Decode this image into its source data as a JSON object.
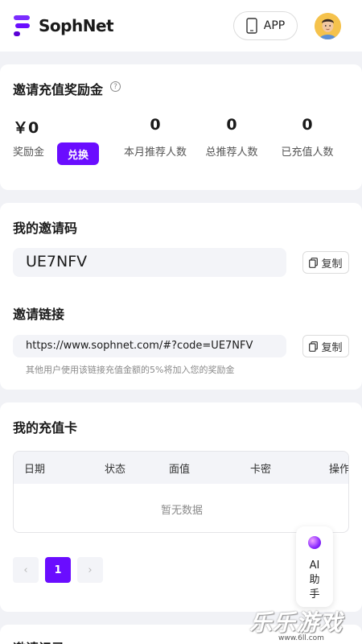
{
  "header": {
    "brand": "SophNet",
    "app_label": "APP",
    "icons": {
      "logo": "sophnet-logo-icon",
      "app": "phone-icon",
      "avatar": "user-avatar"
    },
    "colors": {
      "brand_purple": "#6a0dff"
    }
  },
  "reward": {
    "title": "邀请充值奖励金",
    "help_icon": "question-circle-icon",
    "balance_value": "￥0",
    "balance_label": "奖励金",
    "redeem_label": "兑换",
    "stats": [
      {
        "value": "0",
        "label": "本月推荐人数"
      },
      {
        "value": "0",
        "label": "总推荐人数"
      },
      {
        "value": "0",
        "label": "已充值人数"
      }
    ]
  },
  "invite_code": {
    "title": "我的邀请码",
    "code": "UE7NFV",
    "copy_label": "复制"
  },
  "invite_link": {
    "title": "邀请链接",
    "url": "https://www.sophnet.com/#?code=UE7NFV",
    "copy_label": "复制",
    "hint": "其他用户使用该链接充值金额的5%将加入您的奖励金"
  },
  "recharge_cards": {
    "title": "我的充值卡",
    "columns": [
      "日期",
      "状态",
      "面值",
      "卡密",
      "操作"
    ],
    "empty_text": "暂无数据",
    "pagination": {
      "prev": "‹",
      "current": "1",
      "next": "›"
    }
  },
  "ai_assistant": {
    "line1": "AI",
    "line2": "助",
    "line3": "手"
  },
  "next_section": {
    "title": "邀请记录"
  },
  "watermark": {
    "text": "乐乐游戏",
    "url": "www.6ll.com"
  }
}
